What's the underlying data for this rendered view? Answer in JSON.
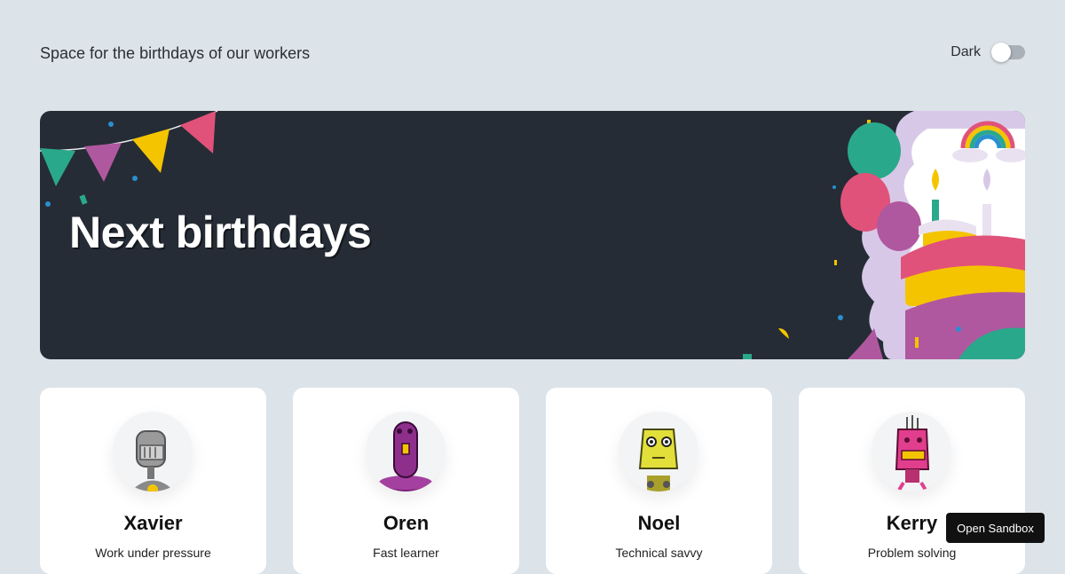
{
  "header": {
    "tagline": "Space for the birthdays of our workers",
    "dark_label": "Dark",
    "dark_enabled": false
  },
  "banner": {
    "title": "Next birthdays",
    "background": "#252c35"
  },
  "workers": [
    {
      "name": "Xavier",
      "skill": "Work under pressure",
      "avatar": "gray-robot-icon",
      "color": "#9a9a9a"
    },
    {
      "name": "Oren",
      "skill": "Fast learner",
      "avatar": "purple-robot-icon",
      "color": "#8e2f8c"
    },
    {
      "name": "Noel",
      "skill": "Technical savvy",
      "avatar": "yellow-robot-icon",
      "color": "#e2df3a"
    },
    {
      "name": "Kerry",
      "skill": "Problem solving",
      "avatar": "pink-robot-icon",
      "color": "#e23e8e"
    }
  ],
  "sandbox": {
    "label": "Open Sandbox"
  },
  "colors": {
    "page_bg": "#dce3e9",
    "card_bg": "#ffffff",
    "accent_pink": "#e0527a",
    "accent_yellow": "#f5c400",
    "accent_teal": "#2aa88c"
  }
}
